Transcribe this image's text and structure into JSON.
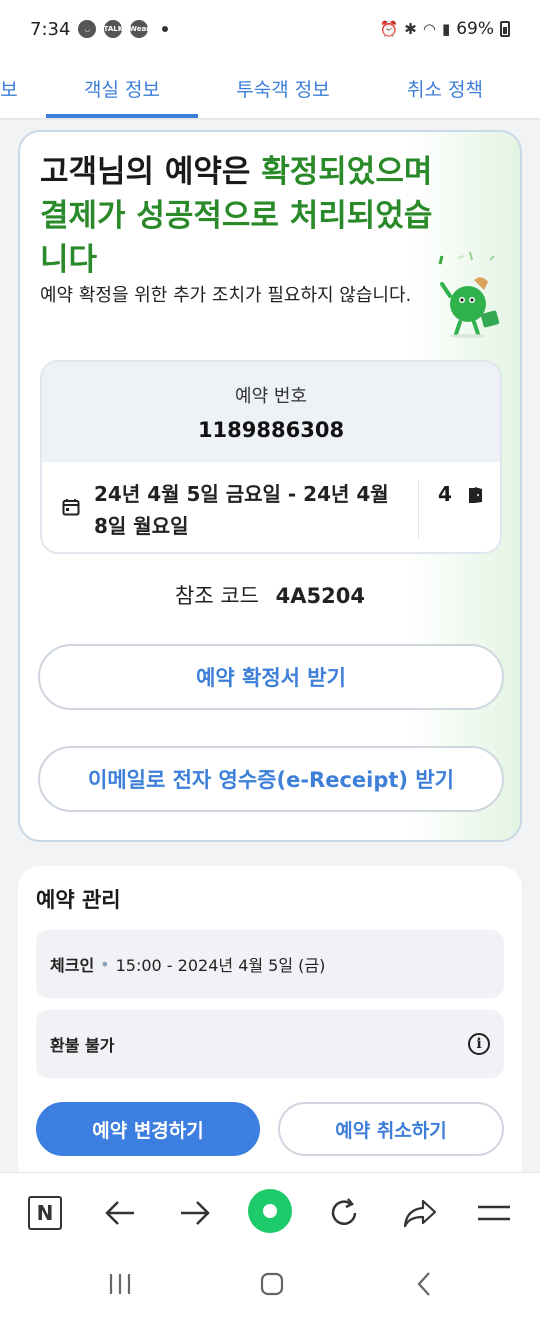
{
  "status": {
    "time": "7:34",
    "battery": "69%",
    "app_icons": [
      "TALK",
      "Wear"
    ]
  },
  "tabs": [
    {
      "label": "보"
    },
    {
      "label": "객실 정보"
    },
    {
      "label": "투숙객 정보"
    },
    {
      "label": "취소 정책"
    }
  ],
  "confirmation": {
    "headline_dark": "고객님의 예약은 ",
    "headline_green": "확정되었으며 결제가 성공적으로 처리되었습니다",
    "subtext": "예약 확정을 위한 추가 조치가 필요하지 않습니다."
  },
  "reservation": {
    "number_label": "예약 번호",
    "number": "1189886308",
    "dates": "24년 4월 5일 금요일 - 24년 4월 8일 월요일",
    "rooms": "4"
  },
  "reference": {
    "label": "참조 코드",
    "code": "4A5204"
  },
  "buttons": {
    "get_confirmation": "예약 확정서 받기",
    "get_receipt": "이메일로 전자 영수증(e-Receipt) 받기"
  },
  "manage": {
    "title": "예약 관리",
    "checkin_label": "체크인",
    "checkin_value": "15:00 - 2024년 4월 5일 (금)",
    "refund": "환불 불가",
    "modify_button": "예약 변경하기",
    "cancel_button": "예약 취소하기"
  },
  "colors": {
    "accent": "#3d7fd9",
    "success": "#2a8a2a",
    "primary_button": "#3d7fe0",
    "browser_green": "#1ecb6a"
  },
  "icons": [
    "alarm-icon",
    "bluetooth-icon",
    "wifi-icon",
    "signal-icon",
    "battery-icon",
    "calendar-icon",
    "door-icon",
    "info-icon",
    "naver-icon",
    "back-icon",
    "forward-icon",
    "home-green-icon",
    "reload-icon",
    "share-icon",
    "menu-icon"
  ]
}
